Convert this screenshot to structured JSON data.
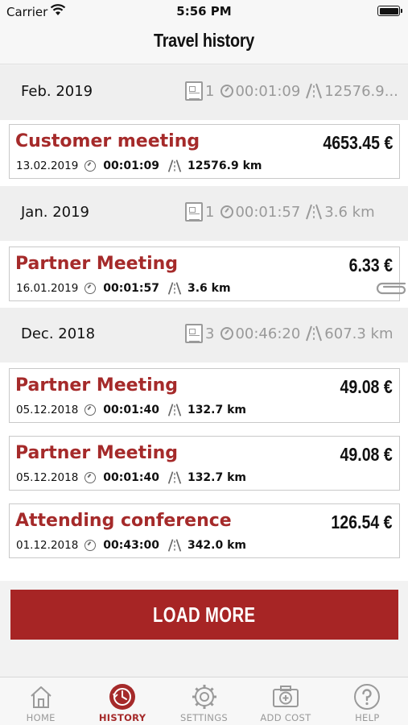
{
  "status_bar": {
    "carrier": "Carrier",
    "time": "5:56 PM"
  },
  "header": {
    "title": "Travel history"
  },
  "months": [
    {
      "label": "Feb. 2019",
      "count": "1",
      "duration": "00:01:09",
      "distance": "12576.9..."
    },
    {
      "label": "Jan. 2019",
      "count": "1",
      "duration": "00:01:57",
      "distance": "3.6 km"
    },
    {
      "label": "Dec. 2018",
      "count": "3",
      "duration": "00:46:20",
      "distance": "607.3 km"
    }
  ],
  "trips": [
    {
      "title": "Customer meeting",
      "amount": "4653.45 €",
      "date": "13.02.2019",
      "duration": "00:01:09",
      "distance": "12576.9 km"
    },
    {
      "title": "Partner Meeting",
      "amount": "6.33 €",
      "date": "16.01.2019",
      "duration": "00:01:57",
      "distance": "3.6 km"
    },
    {
      "title": "Partner Meeting",
      "amount": "49.08 €",
      "date": "05.12.2018",
      "duration": "00:01:40",
      "distance": "132.7 km"
    },
    {
      "title": "Partner Meeting",
      "amount": "49.08 €",
      "date": "05.12.2018",
      "duration": "00:01:40",
      "distance": "132.7 km"
    },
    {
      "title": "Attending conference",
      "amount": "126.54 €",
      "date": "01.12.2018",
      "duration": "00:43:00",
      "distance": "342.0 km"
    }
  ],
  "load_more": {
    "label": "LOAD MORE"
  },
  "tabs": [
    {
      "label": "HOME",
      "icon": "home-icon"
    },
    {
      "label": "HISTORY",
      "icon": "history-icon",
      "active": true
    },
    {
      "label": "SETTINGS",
      "icon": "gear-icon"
    },
    {
      "label": "ADD COST",
      "icon": "add-cost-camera-icon"
    },
    {
      "label": "HELP",
      "icon": "help-icon"
    }
  ],
  "colors": {
    "accent": "#a52a2a",
    "button": "#a72525",
    "muted": "#9a9a9a"
  }
}
